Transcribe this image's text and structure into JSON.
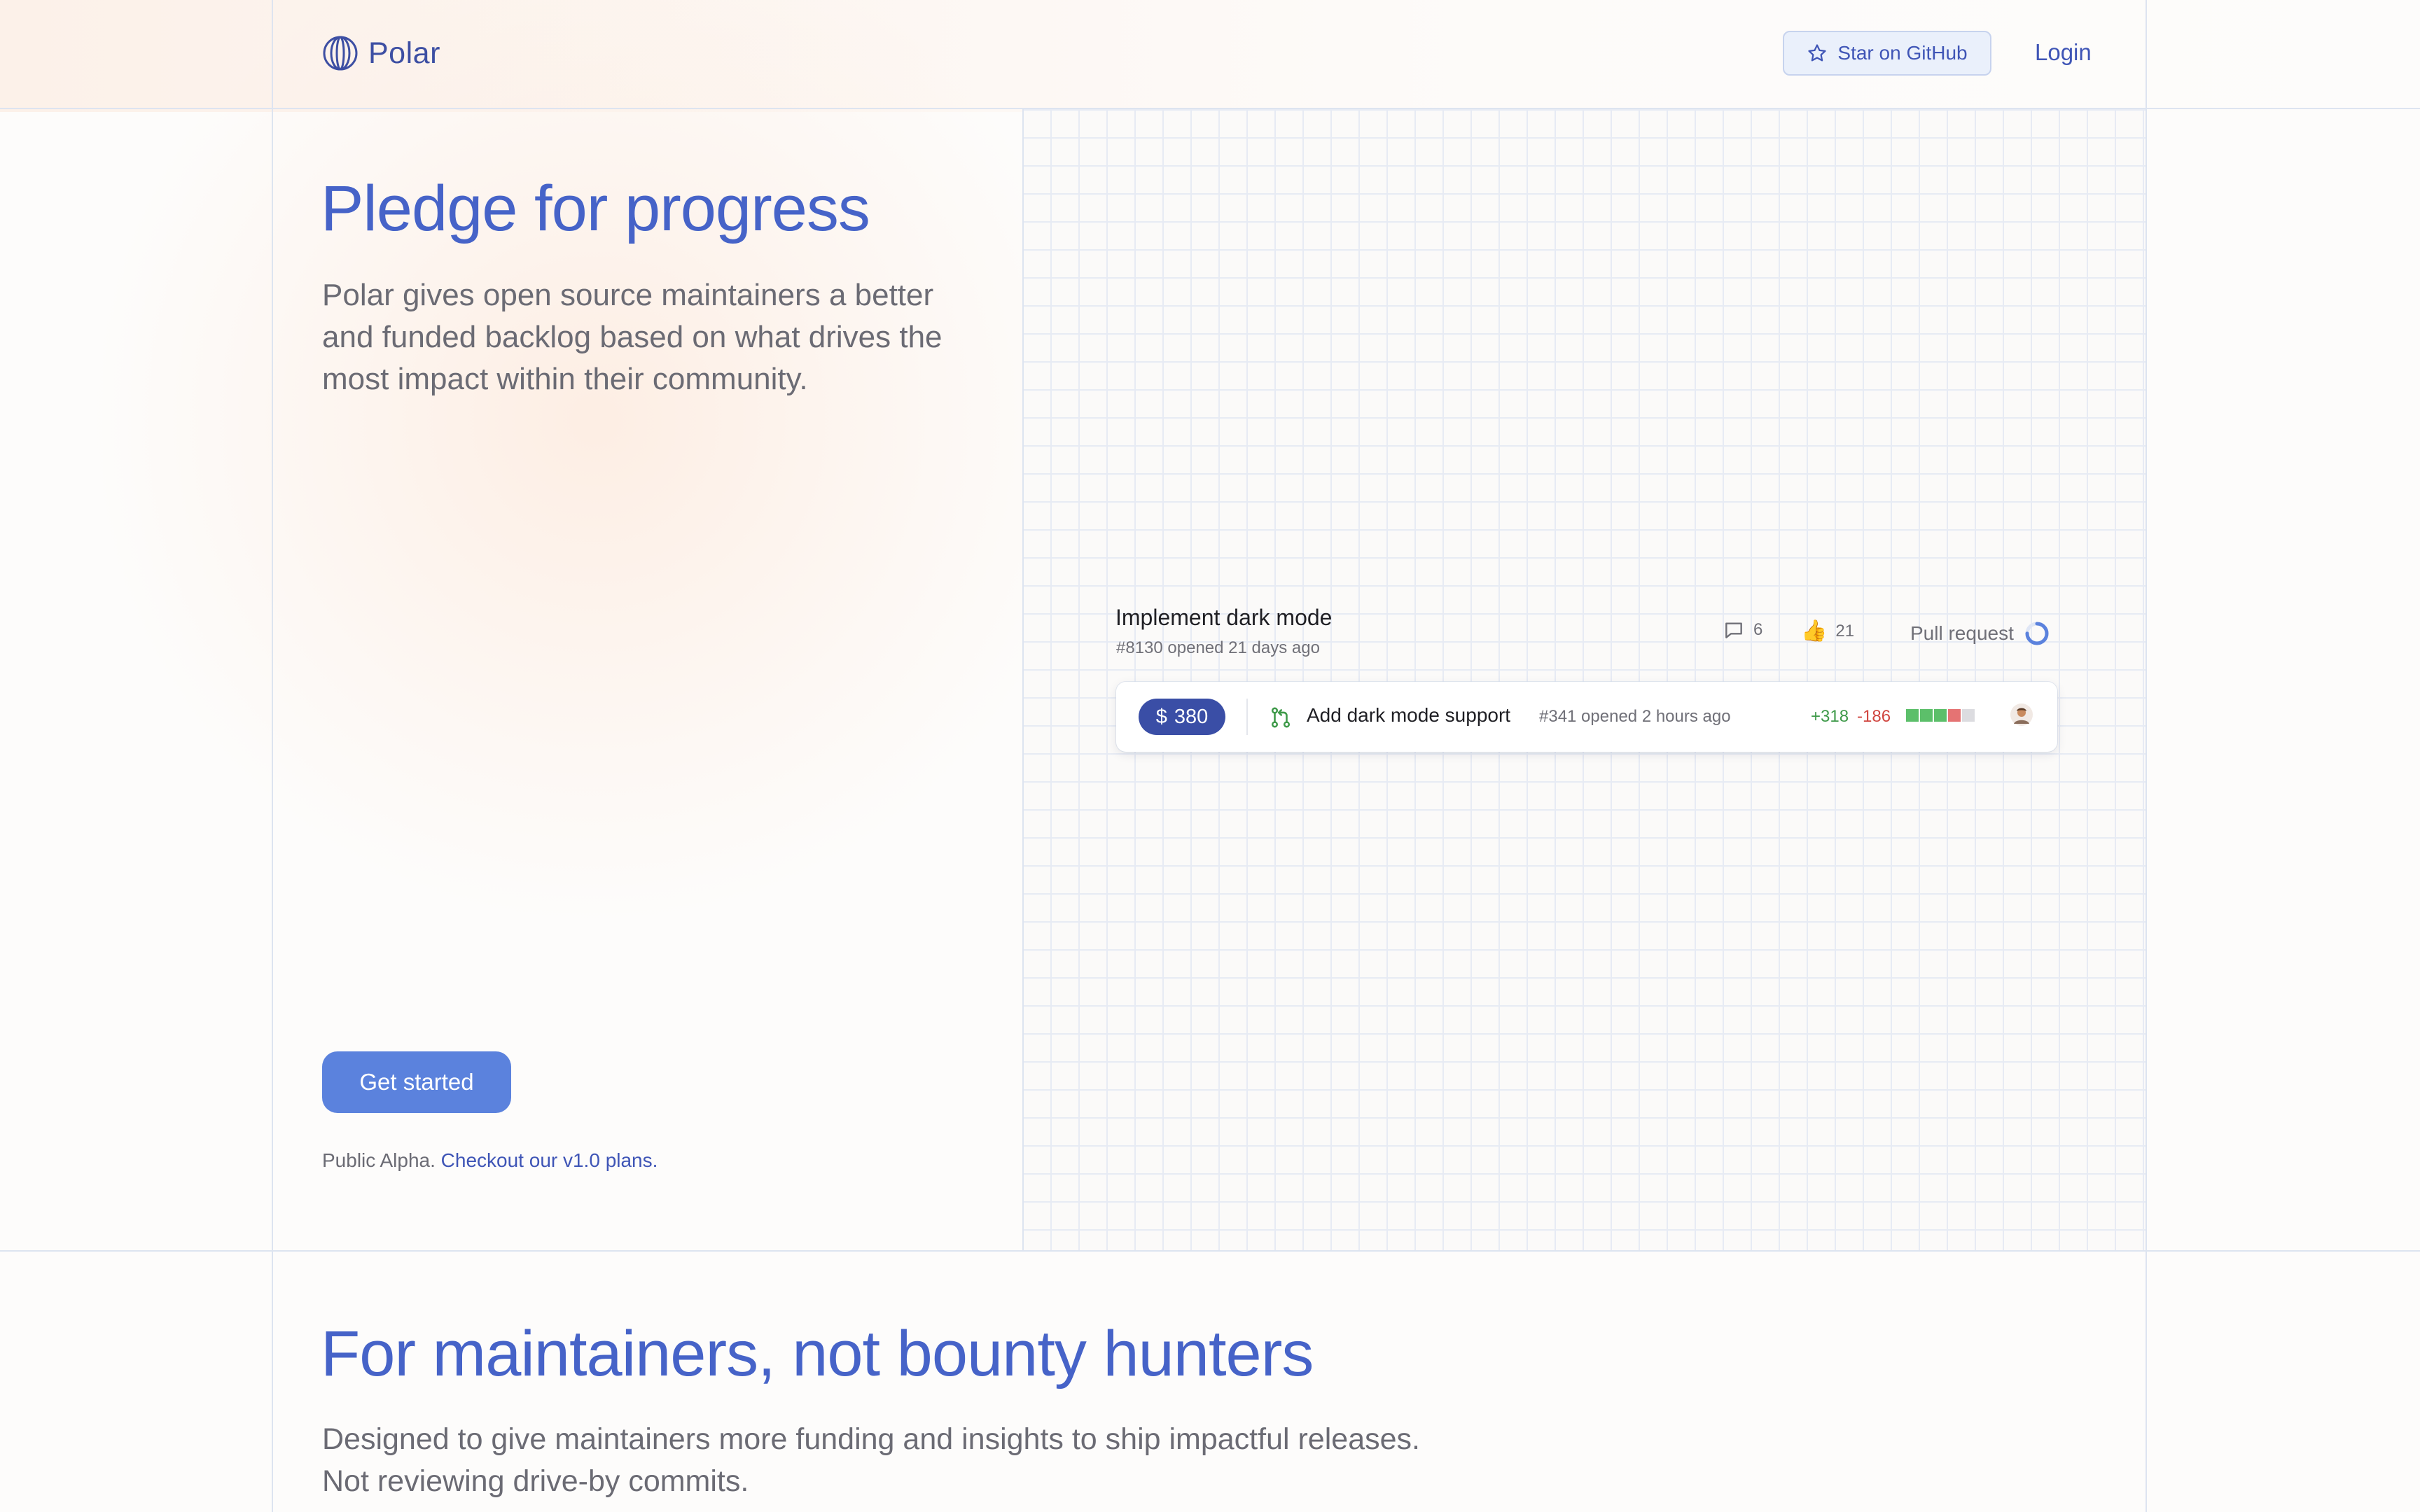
{
  "header": {
    "brand": "Polar",
    "star_label": "Star on GitHub",
    "login_label": "Login"
  },
  "hero": {
    "title": "Pledge for progress",
    "subtitle": "Polar gives open source maintainers a better and funded backlog based on what drives the most impact within their community.",
    "cta_label": "Get started",
    "alpha_text": "Public Alpha.",
    "alpha_link": "Checkout our v1.0 plans."
  },
  "issue": {
    "title": "Implement dark mode",
    "meta": "#8130 opened 21 days ago",
    "comments": "6",
    "thumbs_emoji": "👍",
    "reactions": "21",
    "status_label": "Pull request",
    "status_progress": 0.75
  },
  "pull_request": {
    "pledge_currency": "$",
    "pledge_amount": "380",
    "title": "Add dark mode support",
    "meta": "#341 opened 2 hours ago",
    "additions": "+318",
    "deletions": "-186",
    "diff_blocks": [
      "#5cbf6a",
      "#5cbf6a",
      "#5cbf6a",
      "#e57373",
      "#dcdce0"
    ]
  },
  "section2": {
    "title": "For maintainers, not bounty hunters",
    "line1": "Designed to give maintainers more funding and insights to ship impactful releases.",
    "line2": "Not reviewing drive-by commits."
  },
  "colors": {
    "brand": "#4663c8",
    "button": "#5b82dd",
    "badge": "#3a4ea6",
    "additions": "#3f9a4a",
    "deletions": "#d0453f"
  },
  "icons": {
    "logo": "polar-logo-icon",
    "star": "star-icon",
    "comment": "comment-icon",
    "thumbs": "thumbs-up-icon",
    "pr": "git-pull-request-icon",
    "progress": "progress-ring-icon"
  }
}
